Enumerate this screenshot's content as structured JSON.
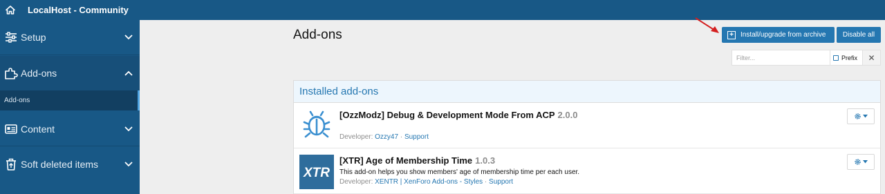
{
  "app": {
    "title": "LocalHost - Community",
    "accent": "#185886",
    "button_color": "#2577b1",
    "link_color": "#2577b1"
  },
  "sidebar": {
    "items": [
      {
        "label": "Setup",
        "icon": "sliders-icon",
        "expanded": false
      },
      {
        "label": "Add-ons",
        "icon": "puzzle-icon",
        "expanded": true,
        "children": [
          {
            "label": "Add-ons",
            "active": true
          }
        ]
      },
      {
        "label": "Content",
        "icon": "id-card-icon",
        "expanded": false
      },
      {
        "label": "Soft deleted items",
        "icon": "trash-icon",
        "expanded": false
      }
    ]
  },
  "main": {
    "title": "Add-ons",
    "actions": {
      "install_label": "Install/upgrade from archive",
      "disable_label": "Disable all"
    },
    "filter": {
      "placeholder": "Filter...",
      "prefix_label": "Prefix",
      "clear_label": "✕"
    },
    "block_title": "Installed add-ons",
    "addons": [
      {
        "name": "[OzzModz] Debug & Development Mode From ACP",
        "version": "2.0.0",
        "description": "",
        "developer_label": "Developer:",
        "developer": "Ozzy47",
        "sep": "·",
        "links": [
          "Support"
        ],
        "icon": "bug-icon"
      },
      {
        "name": "[XTR] Age of Membership Time",
        "version": "1.0.3",
        "description": "This add-on helps you show members' age of membership time per each user.",
        "developer_label": "Developer:",
        "developer": "XENTR | XenForo Add-ons - Styles",
        "sep": "·",
        "links": [
          "Support"
        ],
        "icon": "xtr-logo-icon"
      }
    ]
  }
}
